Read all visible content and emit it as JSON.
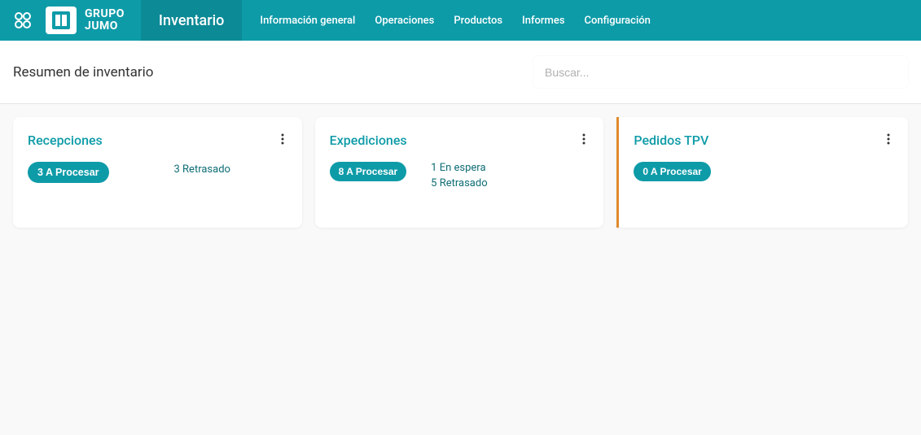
{
  "header": {
    "brand_line1": "GRUPO",
    "brand_line2": "JUMO",
    "app_name": "Inventario",
    "menu": [
      "Información general",
      "Operaciones",
      "Productos",
      "Informes",
      "Configuración"
    ]
  },
  "subheader": {
    "page_title": "Resumen de inventario",
    "search_placeholder": "Buscar..."
  },
  "cards": [
    {
      "title": "Recepciones",
      "process_label": "3 A Procesar",
      "status": [
        "3 Retrasado"
      ]
    },
    {
      "title": "Expediciones",
      "process_label": "8 A Procesar",
      "status": [
        "1 En espera",
        "5 Retrasado"
      ]
    },
    {
      "title": "Pedidos TPV",
      "process_label": "0 A Procesar",
      "status": []
    }
  ]
}
